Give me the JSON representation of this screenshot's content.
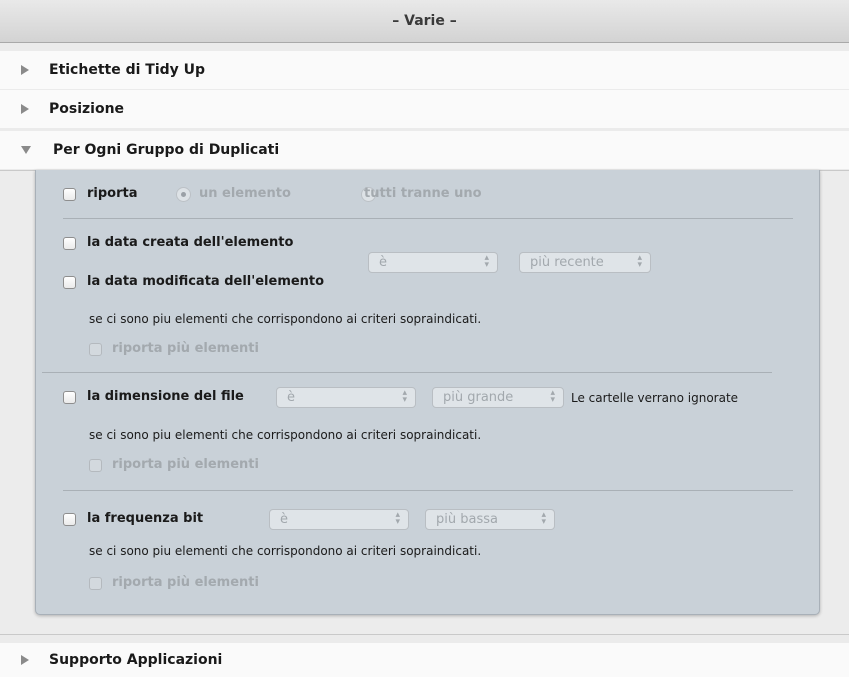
{
  "header": {
    "title": "– Varie –"
  },
  "sections": [
    {
      "label": "Etichette di Tidy Up",
      "expanded": false
    },
    {
      "label": "Posizione",
      "expanded": false
    },
    {
      "label": "Per Ogni Gruppo di Duplicati",
      "expanded": true
    },
    {
      "label": "Supporto Applicazioni",
      "expanded": false
    }
  ],
  "panel": {
    "report": {
      "label": "riporta",
      "radio_one": "un elemento",
      "radio_all": "tutti tranne uno"
    },
    "date": {
      "created_label": "la data creata dell'elemento",
      "modified_label": "la data modificata dell'elemento",
      "op_value": "è",
      "dir_value": "più recente",
      "note": "se ci sono piu elementi che corrispondono ai criteri sopraindicati.",
      "multi_label": "riporta più elementi"
    },
    "size": {
      "label": "la dimensione del file",
      "op_value": "è",
      "dir_value": "più grande",
      "hint": "Le cartelle verrano ignorate",
      "note": "se ci sono piu elementi che corrispondono ai criteri sopraindicati.",
      "multi_label": "riporta più elementi"
    },
    "bitrate": {
      "label": "la frequenza bit",
      "op_value": "è",
      "dir_value": "più bassa",
      "note": "se ci sono piu elementi che corrispondono ai criteri sopraindicati.",
      "multi_label": "riporta più elementi"
    }
  },
  "colors": {
    "panel_bg": "#c9d1d8",
    "disabled_text": "#a3a9ae"
  }
}
